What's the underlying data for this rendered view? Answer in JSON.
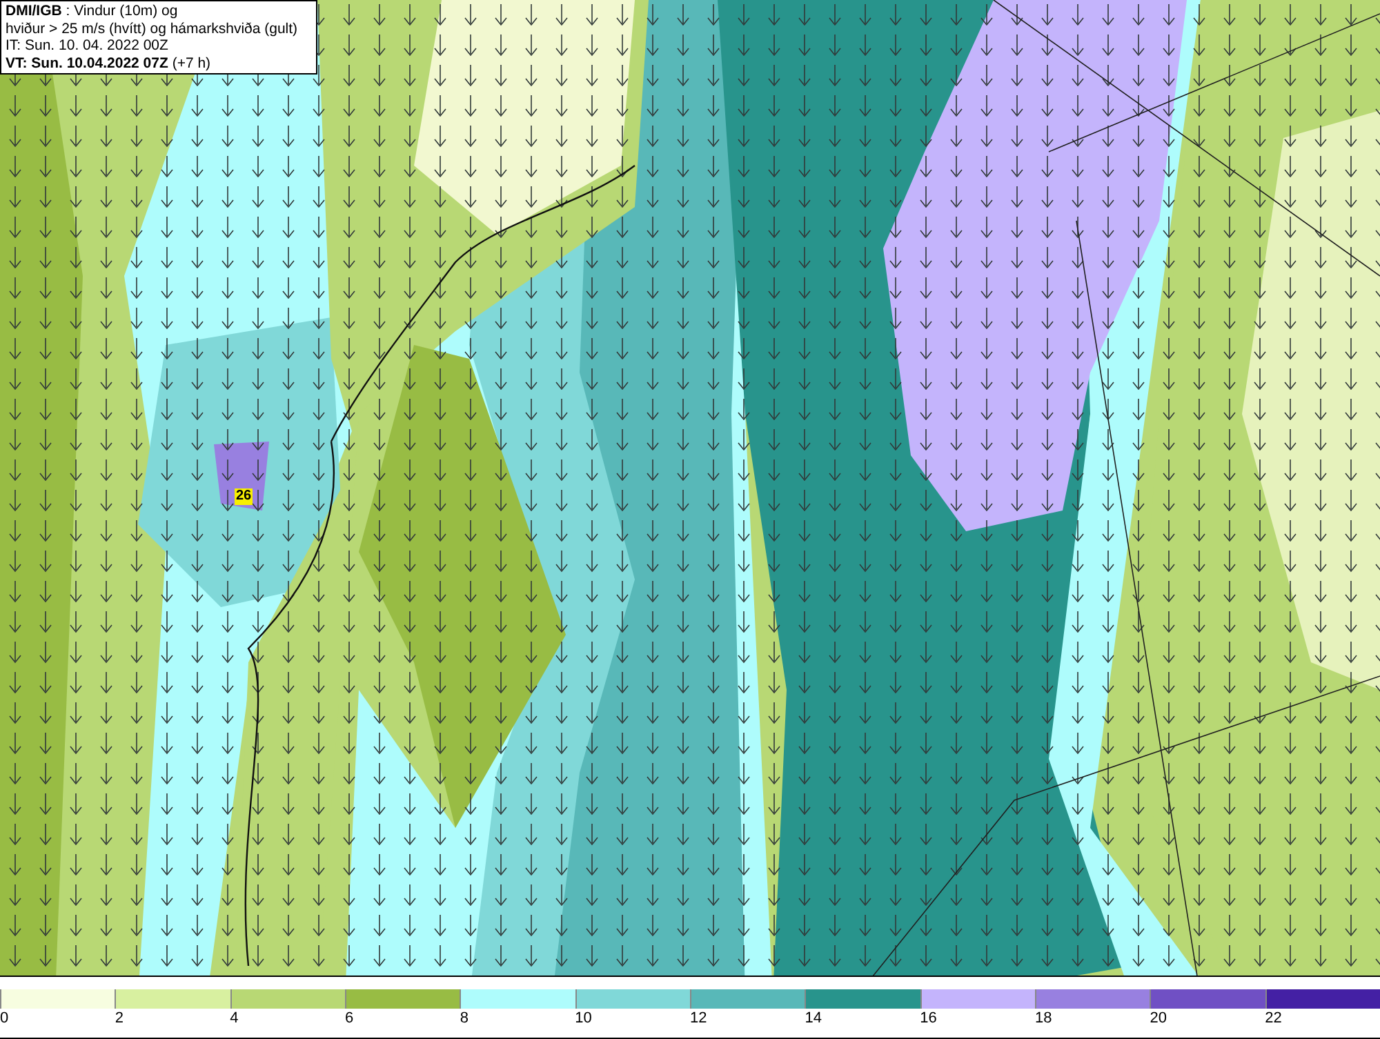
{
  "header": {
    "lines": [
      "**DMI/IGB** : Vindur (10m) og",
      "hviður > 25 m/s (hvítt) og hámarkshviða (gult)",
      "IT: Sun. 10. 04. 2022 00Z",
      "**VT: Sun. 10.04.2022 07Z** (+7 h)"
    ]
  },
  "map": {
    "max_gust_label": "26"
  },
  "legend": [
    {
      "label": "0",
      "color": "#f7fde0"
    },
    {
      "label": "2",
      "color": "#d8f0a0"
    },
    {
      "label": "4",
      "color": "#b8d874"
    },
    {
      "label": "6",
      "color": "#98bc44"
    },
    {
      "label": "8",
      "color": "#aefcfc"
    },
    {
      "label": "10",
      "color": "#80d8d8"
    },
    {
      "label": "12",
      "color": "#58b8b8"
    },
    {
      "label": "14",
      "color": "#28948c"
    },
    {
      "label": "16",
      "color": "#c4b4fc"
    },
    {
      "label": "18",
      "color": "#9880e0"
    },
    {
      "label": "20",
      "color": "#7050c4"
    },
    {
      "label": "22",
      "color": "#4420a4"
    }
  ]
}
